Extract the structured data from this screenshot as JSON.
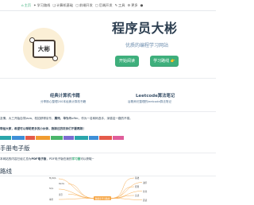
{
  "nav": {
    "items": [
      {
        "icon": "home-icon",
        "glyph": "⌂",
        "label": "主页",
        "active": true
      },
      {
        "icon": "fire-icon",
        "glyph": "✦",
        "label": "学习路线"
      },
      {
        "icon": "book-icon",
        "glyph": "❏",
        "label": "计算机基础"
      },
      {
        "icon": "code-icon",
        "glyph": "▢",
        "label": "前端开发"
      },
      {
        "icon": "code-icon",
        "glyph": "▢",
        "label": "后端开发"
      },
      {
        "icon": "tool-icon",
        "glyph": "✎",
        "label": "工具"
      },
      {
        "icon": "gear-icon",
        "glyph": "⚙",
        "label": "更多"
      },
      {
        "icon": "github-icon",
        "glyph": "●",
        "label": ""
      }
    ]
  },
  "hero": {
    "logo_text": "大彬",
    "title": "程序员大彬",
    "tagline": "优质的编程学习网站",
    "btn_start": "开始阅读",
    "btn_learn": "学习路线 👉"
  },
  "features": [
    {
      "title": "经典计算机书籍",
      "desc": "分享核心整理200本经典计算机书籍"
    },
    {
      "title": "Leetcode算法笔记",
      "desc": "谷歌师兄整理的leetcode算法笔记"
    }
  ],
  "article": {
    "line1_pre": "友情，",
    "line1_mid": "大三开始自学Java，校招获得京东、",
    "line1_b1": "腾讯",
    "line1_mid2": "、",
    "line1_b2": "华为",
    "line1_post": "等offer。作为一名转码选手，深感这一路的不易。",
    "line2": "带给大家，希望可以帮助更多的小伙伴，我踩过的坑你们不要再踩！",
    "banner_colors": [
      "#2aa6ab",
      "#3e8fd8",
      "#e55a4a",
      "#f09c30",
      "#4ab56a",
      "#7c6cd1",
      "#2aa6ab",
      "#3e8fd8",
      "#e55a4a",
      "#e05d9a"
    ]
  },
  "section_ebook": {
    "heading": "手册电子版",
    "text_pre": "本网站的内容已经汇总为",
    "text_pdf": "PDF电子版",
    "text_mid": "，PDF电子版在我的",
    "text_hl": "学习圈",
    "text_post": "可以获取~"
  },
  "section_route": {
    "heading": "路线"
  },
  "mindmap": {
    "center": "数据库学习路线",
    "left_nodes": [
      "MySQL",
      "Redis",
      "SQL",
      "索引",
      "事务"
    ],
    "right_nodes": [
      "基础",
      "进阶",
      "原理",
      "优化",
      "实战",
      "面试"
    ]
  }
}
